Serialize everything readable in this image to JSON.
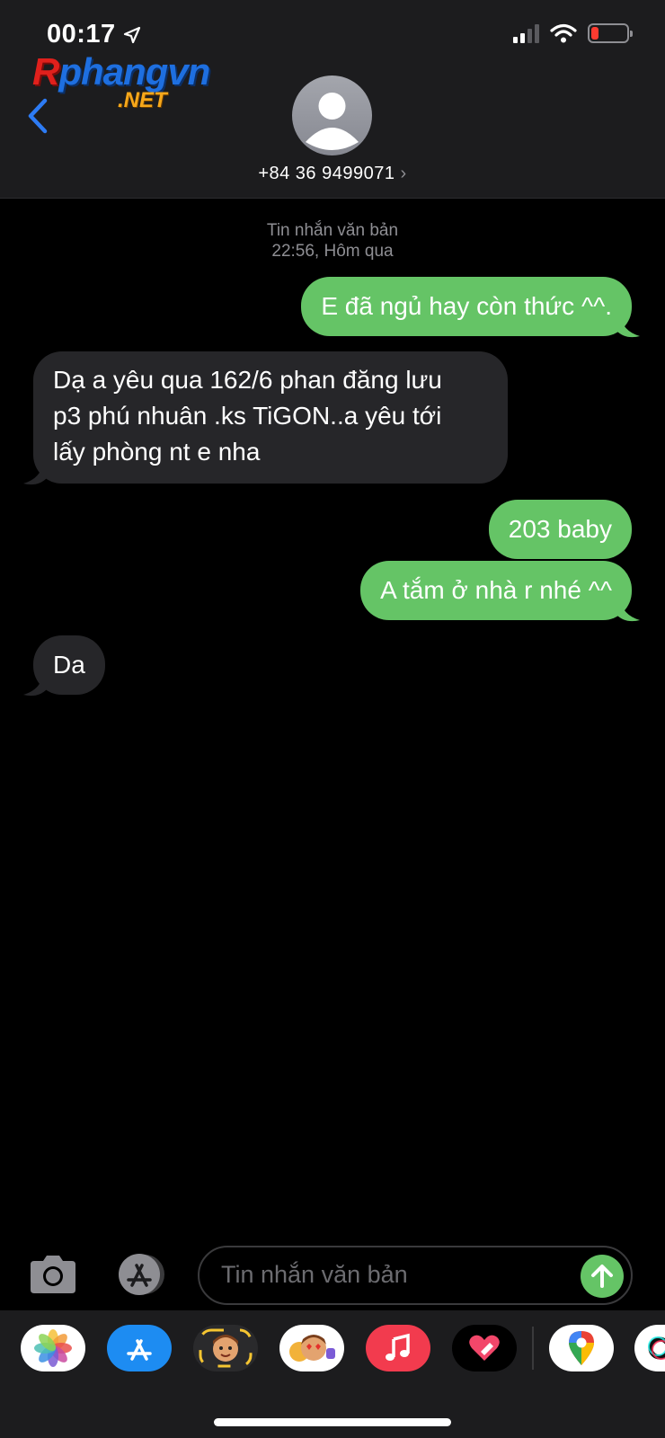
{
  "status": {
    "time": "00:17"
  },
  "watermark": {
    "main_a": "R",
    "main_b": "phangvn",
    "net": ".NET"
  },
  "header": {
    "contact_number": "+84 36 9499071",
    "chevron": "›"
  },
  "thread": {
    "service_label": "Tin nhắn văn bản",
    "timestamp": "22:56, Hôm qua",
    "messages": [
      {
        "direction": "outgoing",
        "text": "E đã ngủ hay còn thức ^^."
      },
      {
        "direction": "incoming",
        "lines": [
          "Dạ  a yêu  qua 162/6 phan đăng lưu",
          "p3 phú nhuân .ks TiGON..a yêu tới",
          "lấy phòng nt e nha"
        ]
      },
      {
        "direction": "outgoing",
        "text": "203 baby"
      },
      {
        "direction": "outgoing",
        "text": "A tắm ở nhà r nhé ^^"
      },
      {
        "direction": "incoming",
        "text": "Da"
      }
    ]
  },
  "composer": {
    "placeholder": "Tin nhắn văn bản"
  },
  "app_drawer": [
    "photos-icon",
    "app-store-icon",
    "memoji-icon",
    "animoji-icon",
    "music-icon",
    "digital-touch-icon",
    "maps-icon",
    "partial-app-icon"
  ],
  "colors": {
    "outgoing_bubble": "#65c466",
    "incoming_bubble": "#262629",
    "accent": "#0a84ff"
  }
}
